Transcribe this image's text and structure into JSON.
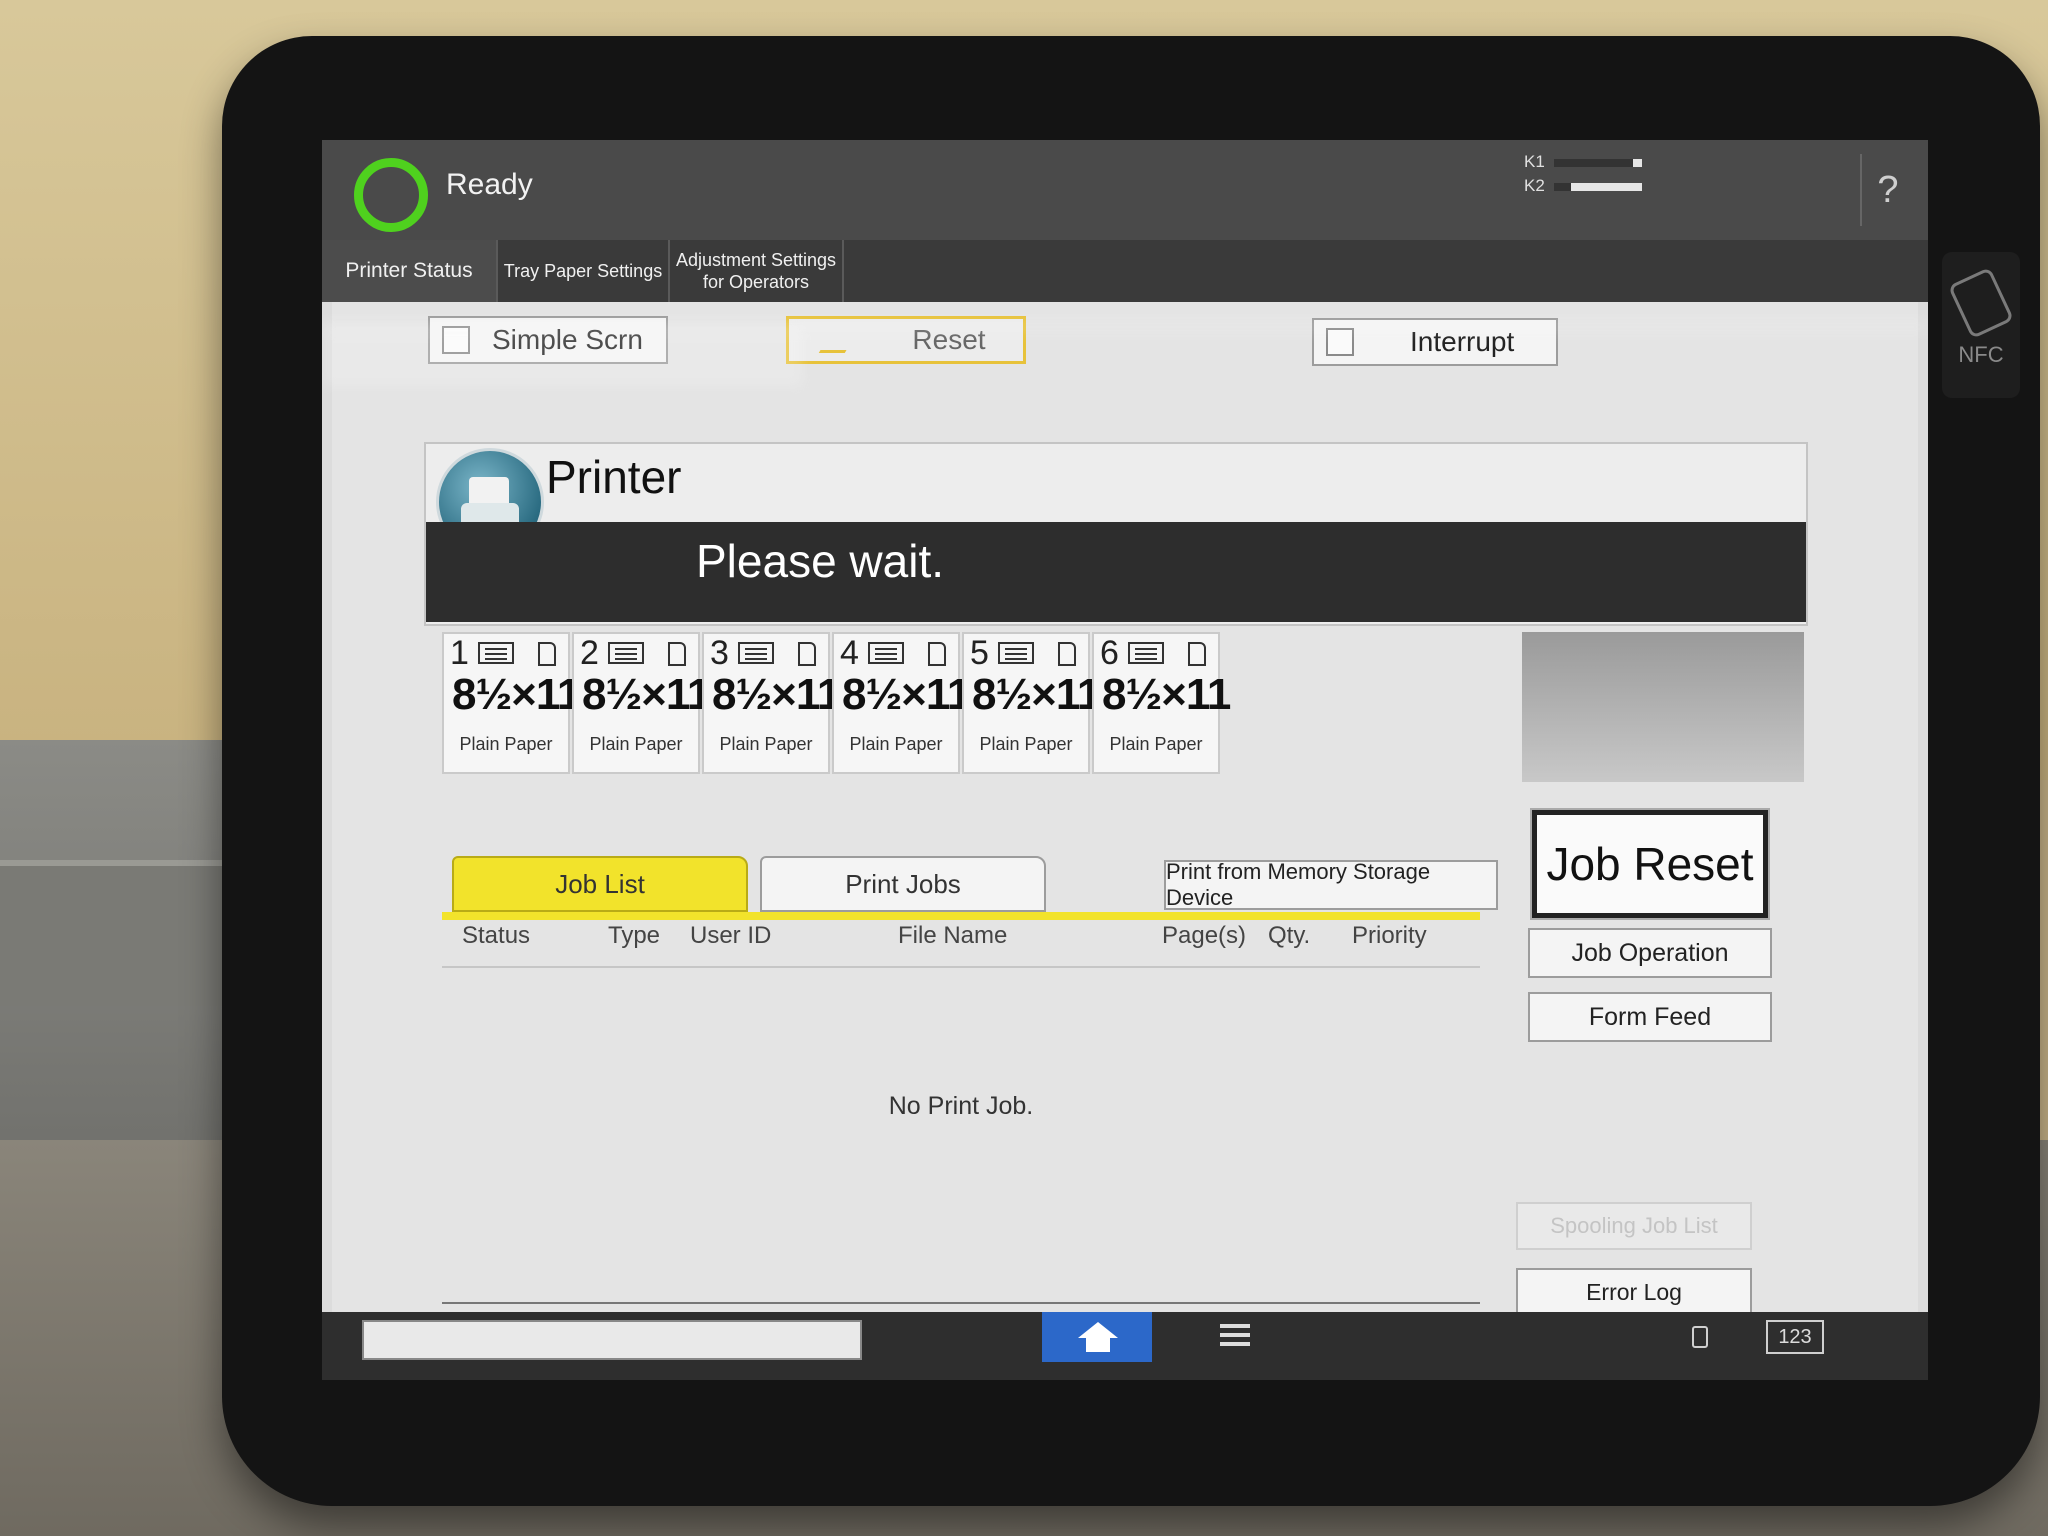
{
  "status": {
    "state_label": "Ready",
    "toner": [
      {
        "label": "K1",
        "level": 0.1
      },
      {
        "label": "K2",
        "level": 0.8
      }
    ],
    "help_label": "?"
  },
  "device": {
    "nfc_label": "NFC"
  },
  "tabs": [
    {
      "label": "Printer Status",
      "selected": true
    },
    {
      "label": "Tray Paper Settings",
      "selected": false
    },
    {
      "label": "Adjustment Settings for Operators",
      "selected": false
    }
  ],
  "controls": {
    "simple_screen": "Simple Scrn",
    "reset": "Reset",
    "interrupt": "Interrupt"
  },
  "printer": {
    "title": "Printer",
    "message": "Please wait."
  },
  "trays": [
    {
      "number": "1",
      "size": "8½×11",
      "paper_type": "Plain Paper"
    },
    {
      "number": "2",
      "size": "8½×11",
      "paper_type": "Plain Paper"
    },
    {
      "number": "3",
      "size": "8½×11",
      "paper_type": "Plain Paper"
    },
    {
      "number": "4",
      "size": "8½×11",
      "paper_type": "Plain Paper"
    },
    {
      "number": "5",
      "size": "8½×11",
      "paper_type": "Plain Paper"
    },
    {
      "number": "6",
      "size": "8½×11",
      "paper_type": "Plain Paper"
    }
  ],
  "job_tabs": {
    "job_list": "Job List",
    "print_jobs": "Print Jobs"
  },
  "actions": {
    "print_from_memory": "Print from Memory Storage Device",
    "job_reset": "Job Reset",
    "job_operation": "Job Operation",
    "form_feed": "Form Feed",
    "spooling_job_list": "Spooling Job List",
    "error_log": "Error Log"
  },
  "job_table": {
    "columns": [
      "Status",
      "Type",
      "User ID",
      "File Name",
      "Page(s)",
      "Qty.",
      "Priority"
    ],
    "empty_message": "No Print Job."
  },
  "bottom_bar": {
    "input_mode": "123"
  },
  "colors": {
    "ready_ring": "#4fd11e",
    "active_tab": "#f2e32b",
    "home_button": "#2c68c9"
  }
}
